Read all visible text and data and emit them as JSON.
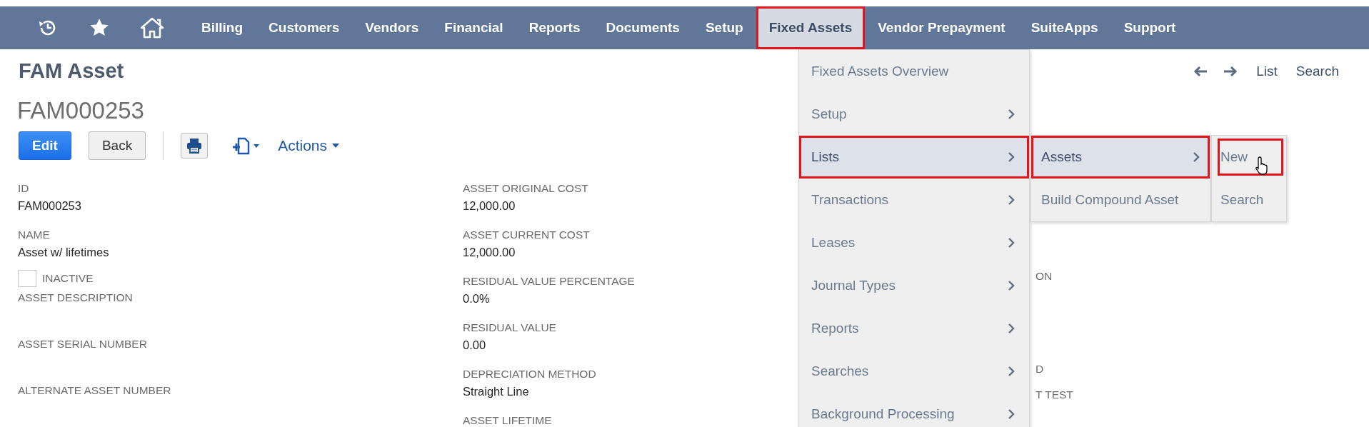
{
  "nav": {
    "items": [
      {
        "label": "Billing",
        "selected": false,
        "highlighted": false
      },
      {
        "label": "Customers",
        "selected": false,
        "highlighted": false
      },
      {
        "label": "Vendors",
        "selected": false,
        "highlighted": false
      },
      {
        "label": "Financial",
        "selected": false,
        "highlighted": false
      },
      {
        "label": "Reports",
        "selected": false,
        "highlighted": false
      },
      {
        "label": "Documents",
        "selected": false,
        "highlighted": false
      },
      {
        "label": "Setup",
        "selected": false,
        "highlighted": false
      },
      {
        "label": "Fixed Assets",
        "selected": true,
        "highlighted": true
      },
      {
        "label": "Vendor Prepayment",
        "selected": false,
        "highlighted": false
      },
      {
        "label": "SuiteApps",
        "selected": false,
        "highlighted": false
      },
      {
        "label": "Support",
        "selected": false,
        "highlighted": false
      }
    ]
  },
  "menu": {
    "items": [
      {
        "label": "Fixed Assets Overview",
        "has_submenu": false,
        "selected": false,
        "highlighted": false
      },
      {
        "label": "Setup",
        "has_submenu": true,
        "selected": false,
        "highlighted": false
      },
      {
        "label": "Lists",
        "has_submenu": true,
        "selected": true,
        "highlighted": true,
        "children": [
          {
            "label": "Assets",
            "has_submenu": true,
            "selected": true,
            "highlighted": true,
            "children": [
              {
                "label": "New",
                "has_submenu": false,
                "selected": false,
                "highlighted": true
              },
              {
                "label": "Search",
                "has_submenu": false,
                "selected": false,
                "highlighted": false
              }
            ]
          },
          {
            "label": "Build Compound Asset",
            "has_submenu": false,
            "selected": false,
            "highlighted": false
          }
        ]
      },
      {
        "label": "Transactions",
        "has_submenu": true,
        "selected": false,
        "highlighted": false
      },
      {
        "label": "Leases",
        "has_submenu": true,
        "selected": false,
        "highlighted": false
      },
      {
        "label": "Journal Types",
        "has_submenu": true,
        "selected": false,
        "highlighted": false
      },
      {
        "label": "Reports",
        "has_submenu": true,
        "selected": false,
        "highlighted": false
      },
      {
        "label": "Searches",
        "has_submenu": true,
        "selected": false,
        "highlighted": false
      },
      {
        "label": "Background Processing",
        "has_submenu": true,
        "selected": false,
        "highlighted": false
      }
    ]
  },
  "header": {
    "title": "FAM Asset",
    "record": "FAM000253",
    "record_nav": [
      "List",
      "Search"
    ]
  },
  "toolbar": {
    "edit": "Edit",
    "back": "Back",
    "actions": "Actions"
  },
  "columns": [
    [
      {
        "kind": "field",
        "label": "ID",
        "value": "FAM000253"
      },
      {
        "kind": "field",
        "label": "NAME",
        "value": "Asset w/ lifetimes"
      },
      {
        "kind": "checkbox",
        "label": "INACTIVE",
        "checked": false
      },
      {
        "kind": "field",
        "label": "ASSET DESCRIPTION"
      },
      {
        "kind": "field",
        "label": "ASSET SERIAL NUMBER"
      },
      {
        "kind": "field",
        "label": "ALTERNATE ASSET NUMBER"
      }
    ],
    [
      {
        "kind": "field",
        "label": "ASSET ORIGINAL COST",
        "value": "12,000.00"
      },
      {
        "kind": "field",
        "label": "ASSET CURRENT COST",
        "value": "12,000.00"
      },
      {
        "kind": "field",
        "label": "RESIDUAL VALUE PERCENTAGE",
        "value": "0.0%"
      },
      {
        "kind": "field",
        "label": "RESIDUAL VALUE",
        "value": "0.00"
      },
      {
        "kind": "field",
        "label": "DEPRECIATION METHOD",
        "value": "Straight Line"
      },
      {
        "kind": "field",
        "label": "ASSET LIFETIME"
      }
    ],
    [
      {
        "kind": "fragment",
        "label": "ON"
      },
      {
        "kind": "fragment",
        "label": "D"
      },
      {
        "kind": "fragment",
        "label": "T TEST"
      }
    ]
  ]
}
